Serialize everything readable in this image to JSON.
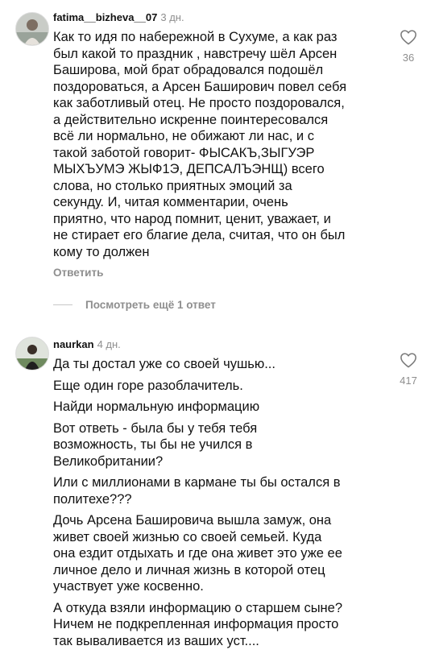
{
  "comments": [
    {
      "username": "fatima__bizheva__07",
      "time": "3 дн.",
      "text_lines": [
        "Как то идя по набережной в Сухуме, а как раз",
        "был какой то праздник , навстречу шёл Арсен",
        "Баширова, мой брат обрадовался подошёл",
        "поздороваться, а Арсен Баширович повел себя",
        "как заботливый отец. Не просто поздоровался,",
        "а действительно искренне поинтересовался",
        "всё ли нормально, не обижают ли нас, и с",
        "такой заботой говорит- ФЫСАКЪ,ЗЫГУЭР",
        "МЫХЪУМЭ ЖЫФ1Э, ДЕПСАЛЪЭНЩ)  всего",
        "слова, но столько приятных эмоций за",
        "секунду.  И, читая комментарии, очень",
        "приятно, что народ помнит, ценит, уважает, и",
        "не стирает его благие дела, считая, что он был",
        "кому то должен"
      ],
      "likes": "36",
      "reply_label": "Ответить",
      "view_replies_label": "Посмотреть ещё 1 ответ"
    },
    {
      "username": "naurkan",
      "time": "4 дн.",
      "paragraphs": [
        [
          "Да ты достал уже со своей чушью..."
        ],
        [
          "Еще один горе разоблачитель."
        ],
        [
          "Найди нормальную информацию"
        ],
        [
          "Вот ответь -  была бы у тебя тебя",
          "возможность, ты бы не учился в",
          "Великобритании?"
        ],
        [
          "Или с миллионами в кармане ты бы остался в",
          "политехе???"
        ],
        [
          "Дочь Арсена Башировича вышла замуж, она",
          "живет своей жизнью со своей семьей. Куда",
          "она ездит отдыхать и где она живет это уже ее",
          "личное дело и личная жизнь в которой отец",
          "участвует уже косвенно."
        ],
        [
          "А откуда взяли информацию о старшем сыне?",
          "Ничем не подкрепленная информация просто",
          "так вываливается из ваших уст...."
        ]
      ],
      "likes": "417"
    }
  ],
  "icons": {
    "like": "heart-outline-icon"
  }
}
